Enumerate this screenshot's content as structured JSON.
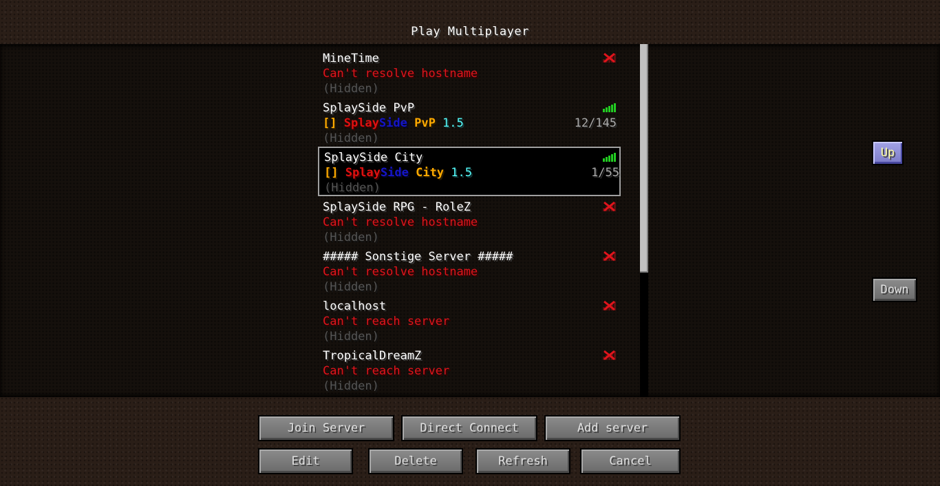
{
  "screen": {
    "title": "Play Multiplayer"
  },
  "servers": [
    {
      "name": "MineTime",
      "status": "Can't resolve hostname",
      "address": "(Hidden)",
      "online": false
    },
    {
      "name": "SplaySide PvP",
      "motd": [
        {
          "text": "[] ",
          "style": "gold"
        },
        {
          "text": "Splay",
          "style": "red"
        },
        {
          "text": "Side ",
          "style": "blue"
        },
        {
          "text": "PvP ",
          "style": "gold"
        },
        {
          "text": "1.5",
          "style": "aqua"
        }
      ],
      "players": "12/145",
      "address": "(Hidden)",
      "online": true
    },
    {
      "name": "SplaySide City",
      "motd": [
        {
          "text": "[] ",
          "style": "gold"
        },
        {
          "text": "Splay",
          "style": "red"
        },
        {
          "text": "Side ",
          "style": "blue"
        },
        {
          "text": "City ",
          "style": "gold"
        },
        {
          "text": "1.5",
          "style": "aqua"
        }
      ],
      "players": "1/55",
      "address": "(Hidden)",
      "online": true,
      "selected": true
    },
    {
      "name": "SplaySide RPG - RoleZ",
      "status": "Can't resolve hostname",
      "address": "(Hidden)",
      "online": false
    },
    {
      "name": "##### Sonstige Server #####",
      "status": "Can't resolve hostname",
      "address": "(Hidden)",
      "online": false
    },
    {
      "name": "localhost",
      "status": "Can't reach server",
      "address": "(Hidden)",
      "online": false
    },
    {
      "name": "TropicalDreamZ",
      "status": "Can't reach server",
      "address": "(Hidden)",
      "online": false
    }
  ],
  "side_buttons": {
    "up": "Up",
    "down": "Down"
  },
  "buttons": {
    "join": "Join Server",
    "direct": "Direct Connect",
    "add": "Add server",
    "edit": "Edit",
    "delete": "Delete",
    "refresh": "Refresh",
    "cancel": "Cancel"
  },
  "colors": {
    "error": "#e0141c",
    "signal": "#22cc22",
    "gold": "#ffaa00",
    "red": "#e01010",
    "blue": "#1515c8",
    "aqua": "#55ffff"
  },
  "icons": {
    "offline": "red-x-icon",
    "online": "signal-bars-icon"
  }
}
